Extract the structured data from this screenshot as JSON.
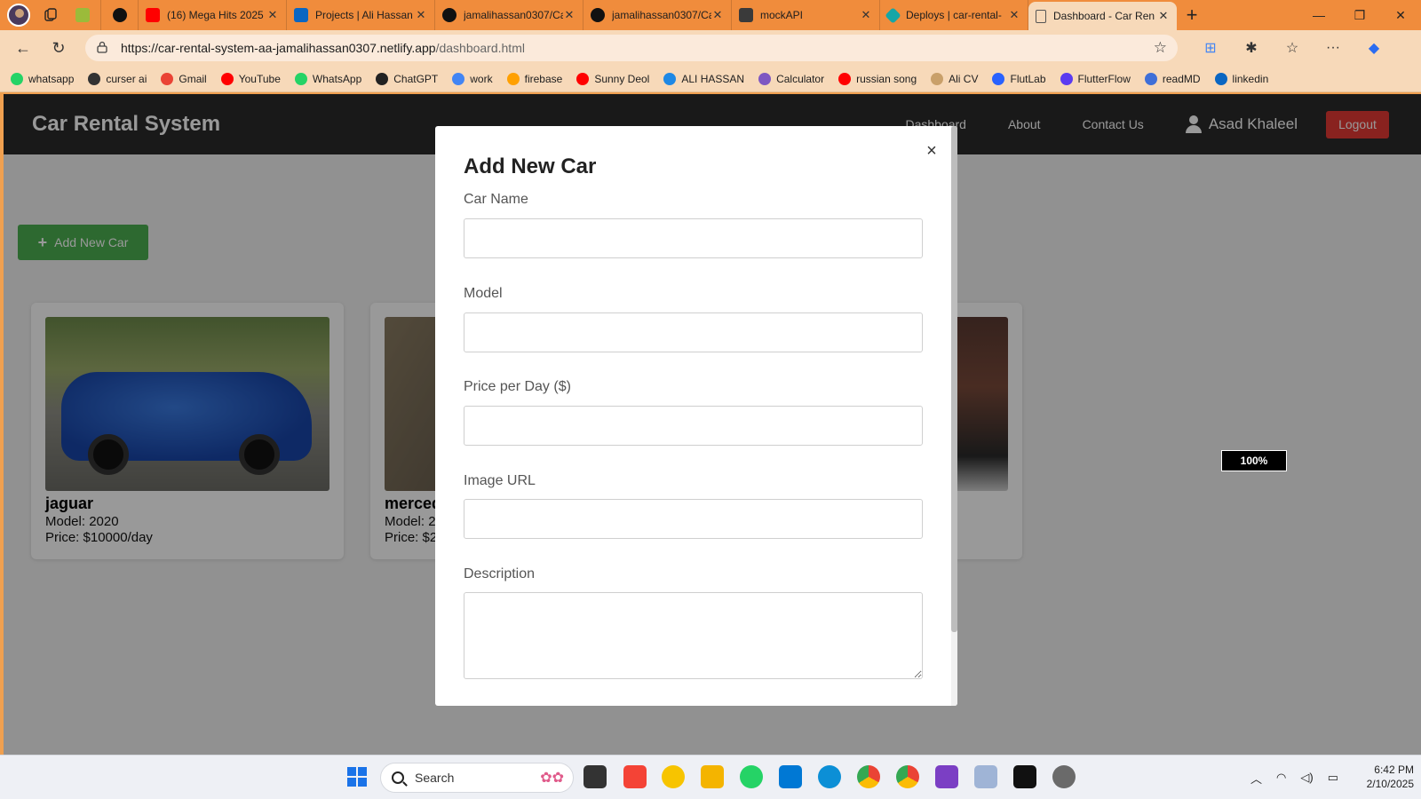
{
  "browser": {
    "tabs": [
      {
        "title": "(16) Mega Hits 2025",
        "fav_color": "#ff0000"
      },
      {
        "title": "Projects | Ali Hassan",
        "fav_color": "#0a66c2"
      },
      {
        "title": "jamalihassan0307/Ca",
        "fav_color": "#111111"
      },
      {
        "title": "jamalihassan0307/Ca",
        "fav_color": "#111111"
      },
      {
        "title": "mockAPI",
        "fav_color": "#3a3a3a"
      },
      {
        "title": "Deploys | car-rental-",
        "fav_color": "#15a6a6"
      },
      {
        "title": "Dashboard - Car Ren",
        "fav_color": "#666666"
      }
    ],
    "url_host": "https://car-rental-system-aa-jamalihassan0307.netlify.app",
    "url_path": "/dashboard.html",
    "bookmarks": [
      {
        "label": "whatsapp",
        "color": "#25d366"
      },
      {
        "label": "curser ai",
        "color": "#333333"
      },
      {
        "label": "Gmail",
        "color": "#ea4335"
      },
      {
        "label": "YouTube",
        "color": "#ff0000"
      },
      {
        "label": "WhatsApp",
        "color": "#25d366"
      },
      {
        "label": "ChatGPT",
        "color": "#222222"
      },
      {
        "label": "work",
        "color": "#4285f4"
      },
      {
        "label": "firebase",
        "color": "#ffa000"
      },
      {
        "label": "Sunny Deol",
        "color": "#ff0000"
      },
      {
        "label": "ALI HASSAN",
        "color": "#1e88e5"
      },
      {
        "label": "Calculator",
        "color": "#7e57c2"
      },
      {
        "label": "russian song",
        "color": "#ff0000"
      },
      {
        "label": "Ali CV",
        "color": "#c9a06a"
      },
      {
        "label": "FlutLab",
        "color": "#2962ff"
      },
      {
        "label": "FlutterFlow",
        "color": "#5b3bf0"
      },
      {
        "label": "readMD",
        "color": "#3f6fd8"
      },
      {
        "label": "linkedin",
        "color": "#0a66c2"
      }
    ]
  },
  "site": {
    "brand": "Car Rental System",
    "nav": [
      "Dashboard",
      "About",
      "Contact Us"
    ],
    "user_name": "Asad Khaleel",
    "logout_label": "Logout",
    "add_car_label": "Add New Car"
  },
  "cars": [
    {
      "name": "jaguar",
      "model": "Model: 2020",
      "price": "Price: $10000/day"
    },
    {
      "name": "merced",
      "model": "Model: 2",
      "price": "Price: $2"
    }
  ],
  "zoom_indicator": "100%",
  "modal": {
    "title": "Add New Car",
    "close": "×",
    "fields": [
      {
        "label": "Car Name",
        "value": ""
      },
      {
        "label": "Model",
        "value": ""
      },
      {
        "label": "Price per Day ($)",
        "value": ""
      },
      {
        "label": "Image URL",
        "value": ""
      },
      {
        "label": "Description",
        "value": ""
      }
    ]
  },
  "taskbar": {
    "search_placeholder": "Search",
    "time": "6:42 PM",
    "date": "2/10/2025",
    "accent": "#1a73e8"
  }
}
